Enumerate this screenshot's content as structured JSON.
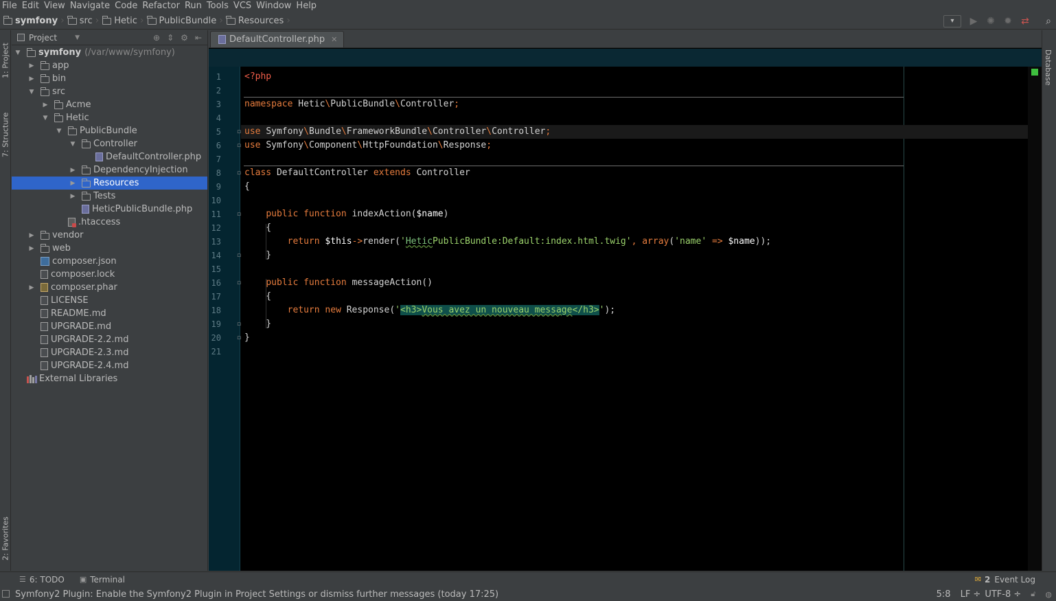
{
  "menu": [
    "File",
    "Edit",
    "View",
    "Navigate",
    "Code",
    "Refactor",
    "Run",
    "Tools",
    "VCS",
    "Window",
    "Help"
  ],
  "breadcrumbs": [
    "symfony",
    "src",
    "Hetic",
    "PublicBundle",
    "Resources"
  ],
  "toolbar": {
    "run_config_label": "▾"
  },
  "side_tabs": {
    "project": "1: Project",
    "structure": "7: Structure",
    "favorites": "2: Favorites",
    "database": "Database"
  },
  "project_panel": {
    "title": "Project"
  },
  "tree": [
    {
      "label": "symfony",
      "extra": "(/var/www/symfony)",
      "depth": 0,
      "type": "root",
      "open": true
    },
    {
      "label": "app",
      "depth": 1,
      "type": "folder",
      "open": false
    },
    {
      "label": "bin",
      "depth": 1,
      "type": "folder",
      "open": false
    },
    {
      "label": "src",
      "depth": 1,
      "type": "folder",
      "open": true
    },
    {
      "label": "Acme",
      "depth": 2,
      "type": "folder",
      "open": false
    },
    {
      "label": "Hetic",
      "depth": 2,
      "type": "folder",
      "open": true
    },
    {
      "label": "PublicBundle",
      "depth": 3,
      "type": "folder",
      "open": true
    },
    {
      "label": "Controller",
      "depth": 4,
      "type": "folder",
      "open": true
    },
    {
      "label": "DefaultController.php",
      "depth": 5,
      "type": "php"
    },
    {
      "label": "DependencyInjection",
      "depth": 4,
      "type": "folder",
      "open": false
    },
    {
      "label": "Resources",
      "depth": 4,
      "type": "folder",
      "open": false,
      "selected": true
    },
    {
      "label": "Tests",
      "depth": 4,
      "type": "folder",
      "open": false
    },
    {
      "label": "HeticPublicBundle.php",
      "depth": 4,
      "type": "php"
    },
    {
      "label": ".htaccess",
      "depth": 3,
      "type": "ht"
    },
    {
      "label": "vendor",
      "depth": 1,
      "type": "folder",
      "open": false
    },
    {
      "label": "web",
      "depth": 1,
      "type": "folder",
      "open": false
    },
    {
      "label": "composer.json",
      "depth": 1,
      "type": "json"
    },
    {
      "label": "composer.lock",
      "depth": 1,
      "type": "file"
    },
    {
      "label": "composer.phar",
      "depth": 1,
      "type": "phar",
      "open": false
    },
    {
      "label": "LICENSE",
      "depth": 1,
      "type": "file"
    },
    {
      "label": "README.md",
      "depth": 1,
      "type": "file"
    },
    {
      "label": "UPGRADE.md",
      "depth": 1,
      "type": "file"
    },
    {
      "label": "UPGRADE-2.2.md",
      "depth": 1,
      "type": "file"
    },
    {
      "label": "UPGRADE-2.3.md",
      "depth": 1,
      "type": "file"
    },
    {
      "label": "UPGRADE-2.4.md",
      "depth": 1,
      "type": "file"
    },
    {
      "label": "External Libraries",
      "depth": 0,
      "type": "lib"
    }
  ],
  "editor": {
    "tab_label": "DefaultController.php",
    "caret_line": 5,
    "lines": [
      [
        [
          "php",
          "<?php"
        ]
      ],
      [],
      [
        [
          "kw",
          "namespace "
        ],
        [
          "pl",
          "Hetic"
        ],
        [
          "op",
          "\\"
        ],
        [
          "pl",
          "PublicBundle"
        ],
        [
          "op",
          "\\"
        ],
        [
          "pl",
          "Controller"
        ],
        [
          "op",
          ";"
        ]
      ],
      [],
      [
        [
          "kw",
          "use "
        ],
        [
          "pl",
          "Symfony"
        ],
        [
          "op",
          "\\"
        ],
        [
          "pl",
          "Bundle"
        ],
        [
          "op",
          "\\"
        ],
        [
          "pl",
          "FrameworkBundle"
        ],
        [
          "op",
          "\\"
        ],
        [
          "pl",
          "Controller"
        ],
        [
          "op",
          "\\"
        ],
        [
          "pl",
          "Controller"
        ],
        [
          "op",
          ";"
        ]
      ],
      [
        [
          "kw",
          "use "
        ],
        [
          "pl",
          "Symfony"
        ],
        [
          "op",
          "\\"
        ],
        [
          "pl",
          "Component"
        ],
        [
          "op",
          "\\"
        ],
        [
          "pl",
          "HttpFoundation"
        ],
        [
          "op",
          "\\"
        ],
        [
          "pl",
          "Response"
        ],
        [
          "op",
          ";"
        ]
      ],
      [],
      [
        [
          "kw",
          "class "
        ],
        [
          "pl",
          "DefaultController "
        ],
        [
          "kw",
          "extends "
        ],
        [
          "pl",
          "Controller"
        ]
      ],
      [
        [
          "pl",
          "{"
        ]
      ],
      [],
      [
        [
          "pl",
          "    "
        ],
        [
          "kw",
          "public function "
        ],
        [
          "pl",
          "indexAction("
        ],
        [
          "var",
          "$name"
        ],
        [
          "pl",
          ")"
        ]
      ],
      [
        [
          "pl",
          "    {"
        ]
      ],
      [
        [
          "pl",
          "        "
        ],
        [
          "kw",
          "return "
        ],
        [
          "var",
          "$this"
        ],
        [
          "op",
          "->"
        ],
        [
          "pl",
          "render("
        ],
        [
          "str",
          "'"
        ],
        [
          "strw",
          "Hetic"
        ],
        [
          "str",
          "PublicBundle:Default:index.html.twig'"
        ],
        [
          "op",
          ", "
        ],
        [
          "kw",
          "array"
        ],
        [
          "pl",
          "("
        ],
        [
          "str",
          "'name'"
        ],
        [
          "op",
          " => "
        ],
        [
          "var",
          "$name"
        ],
        [
          "pl",
          "));"
        ]
      ],
      [
        [
          "pl",
          "    }"
        ]
      ],
      [],
      [
        [
          "pl",
          "    "
        ],
        [
          "kw",
          "public function "
        ],
        [
          "pl",
          "messageAction()"
        ]
      ],
      [
        [
          "pl",
          "    {"
        ]
      ],
      [
        [
          "pl",
          "        "
        ],
        [
          "kw",
          "return new "
        ],
        [
          "pl",
          "Response("
        ],
        [
          "str",
          "'"
        ],
        [
          "hl",
          "<h3>"
        ],
        [
          "hlw",
          "Vous avez un nouveau message"
        ],
        [
          "hl",
          "</h3>"
        ],
        [
          "str",
          "'"
        ],
        [
          "pl",
          ");"
        ]
      ],
      [
        [
          "pl",
          "    }"
        ]
      ],
      [
        [
          "pl",
          "}"
        ]
      ],
      []
    ]
  },
  "bottom_tools": {
    "todo": "6: TODO",
    "terminal": "Terminal",
    "event_log": "Event Log",
    "event_badge": "2"
  },
  "status": {
    "message": "Symfony2 Plugin: Enable the Symfony2 Plugin in Project Settings or dismiss further messages (today 17:25)",
    "position": "5:8",
    "line_sep": "LF ÷",
    "encoding": "UTF-8 ÷"
  },
  "colors": {
    "selection": "#2f65ca",
    "keyword": "#e87d3e",
    "string": "#9cd36c",
    "gutter": "#042530"
  }
}
